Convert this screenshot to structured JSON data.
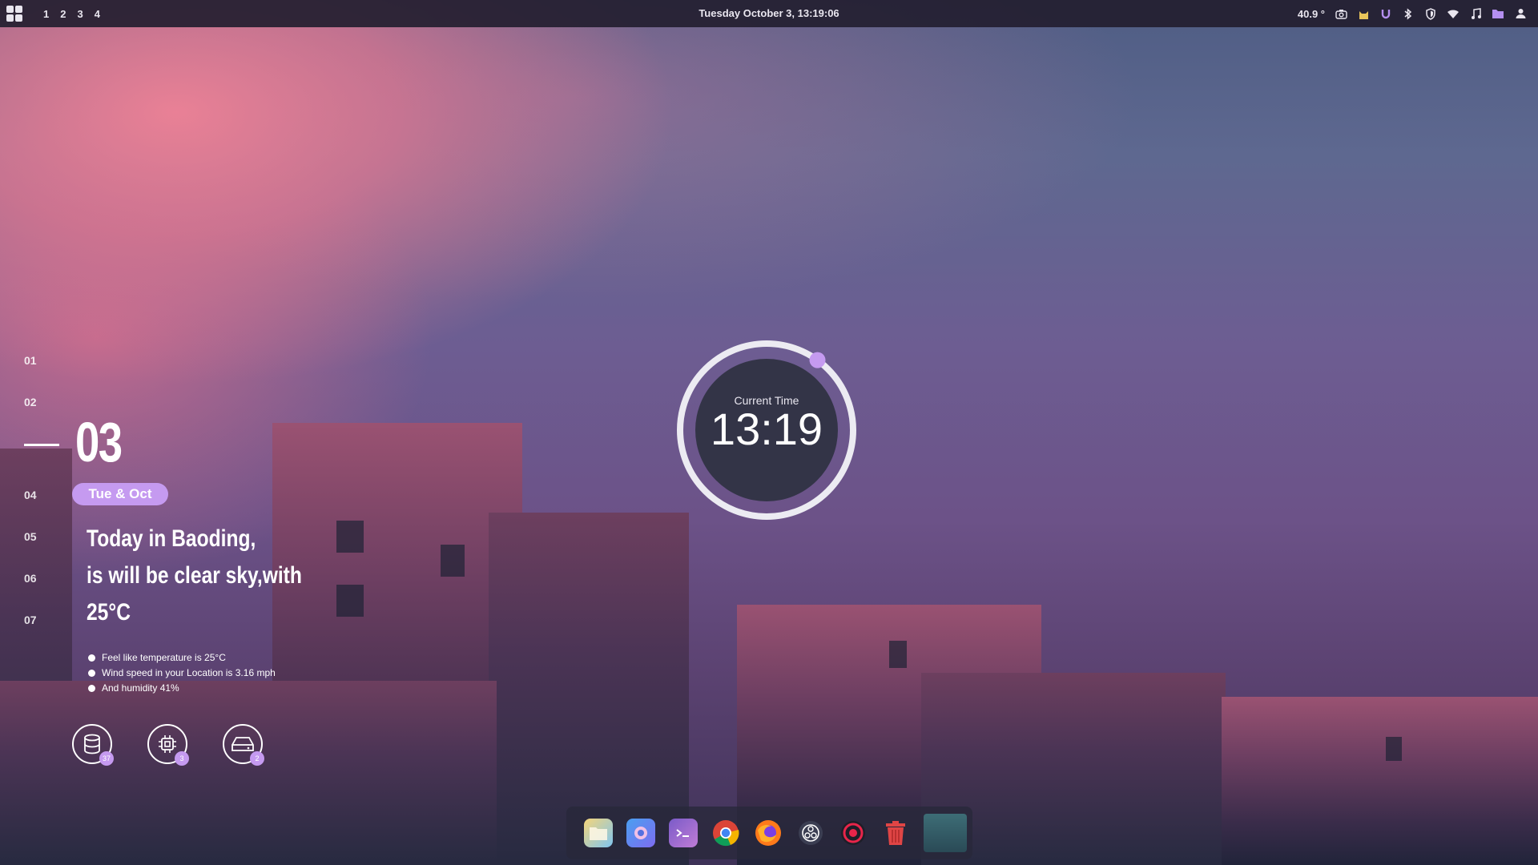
{
  "topbar": {
    "workspaces": [
      "1",
      "2",
      "3",
      "4"
    ],
    "datetime": "Tuesday October  3, 13:19:06",
    "temperature": "40.9 °",
    "tray_icons": [
      "camera-icon",
      "cat-icon",
      "u-icon",
      "bluetooth-icon",
      "shield-icon",
      "wifi-icon",
      "music-icon",
      "folder-icon",
      "user-icon"
    ]
  },
  "days": {
    "list": [
      "01",
      "02",
      "04",
      "05",
      "06",
      "07"
    ],
    "current": "03",
    "pill": "Tue & Oct"
  },
  "weather": {
    "line1": "Today in Baoding,",
    "line2": "is will be clear sky,with",
    "line3": "25°C",
    "details": [
      "Feel like temperature is 25°C",
      "Wind speed in your Location is 3.16 mph",
      "And humidity 41%"
    ]
  },
  "stats": [
    {
      "icon": "database-icon",
      "badge": "37"
    },
    {
      "icon": "cpu-icon",
      "badge": "3"
    },
    {
      "icon": "hard-drive-icon",
      "badge": "2"
    }
  ],
  "clock": {
    "label": "Current Time",
    "time": "13:19",
    "progress": 0.1
  },
  "dock": [
    "files-icon",
    "browser-icon",
    "terminal-icon",
    "chrome-icon",
    "firefox-icon",
    "obs-icon",
    "record-icon",
    "trash-icon",
    "window-preview-icon"
  ],
  "colors": {
    "accent": "#c59af0",
    "clock_face": "#333447",
    "topbar": "#231e30"
  }
}
